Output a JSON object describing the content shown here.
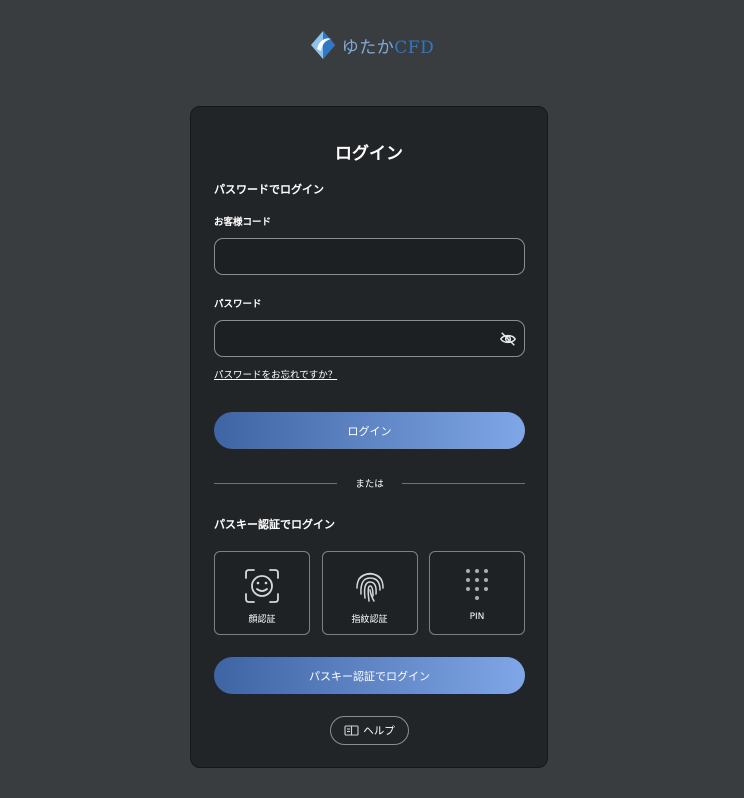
{
  "brand": {
    "name_prefix": "ゆたか",
    "name_suffix": "CFD",
    "icon": "yutaka-logo-icon",
    "colors": {
      "mark_light": "#8fc4ea",
      "mark_dark": "#2f78c4",
      "text": "#7fa9d6"
    }
  },
  "login": {
    "title": "ログイン",
    "password_section_title": "パスワードでログイン",
    "customer_code_label": "お客様コード",
    "customer_code_value": "",
    "password_label": "パスワード",
    "password_value": "",
    "password_toggle_icon": "eye-off-icon",
    "forgot_password_link": "パスワードをお忘れですか？",
    "login_button_label": "ログイン",
    "divider_text": "または",
    "passkey_section_title": "パスキー認証でログイン",
    "passkey_options": [
      {
        "label": "顔認証",
        "icon": "face-id-icon"
      },
      {
        "label": "指紋認証",
        "icon": "fingerprint-icon"
      },
      {
        "label": "PIN",
        "icon": "pin-keypad-icon"
      }
    ],
    "passkey_button_label": "パスキー認証でログイン",
    "help_label": "ヘルプ",
    "help_icon": "book-icon"
  },
  "colors": {
    "page_bg": "#3a3d40",
    "card_bg": "#222528",
    "button_gradient_start": "#3f64a3",
    "button_gradient_end": "#7fa6e6"
  }
}
